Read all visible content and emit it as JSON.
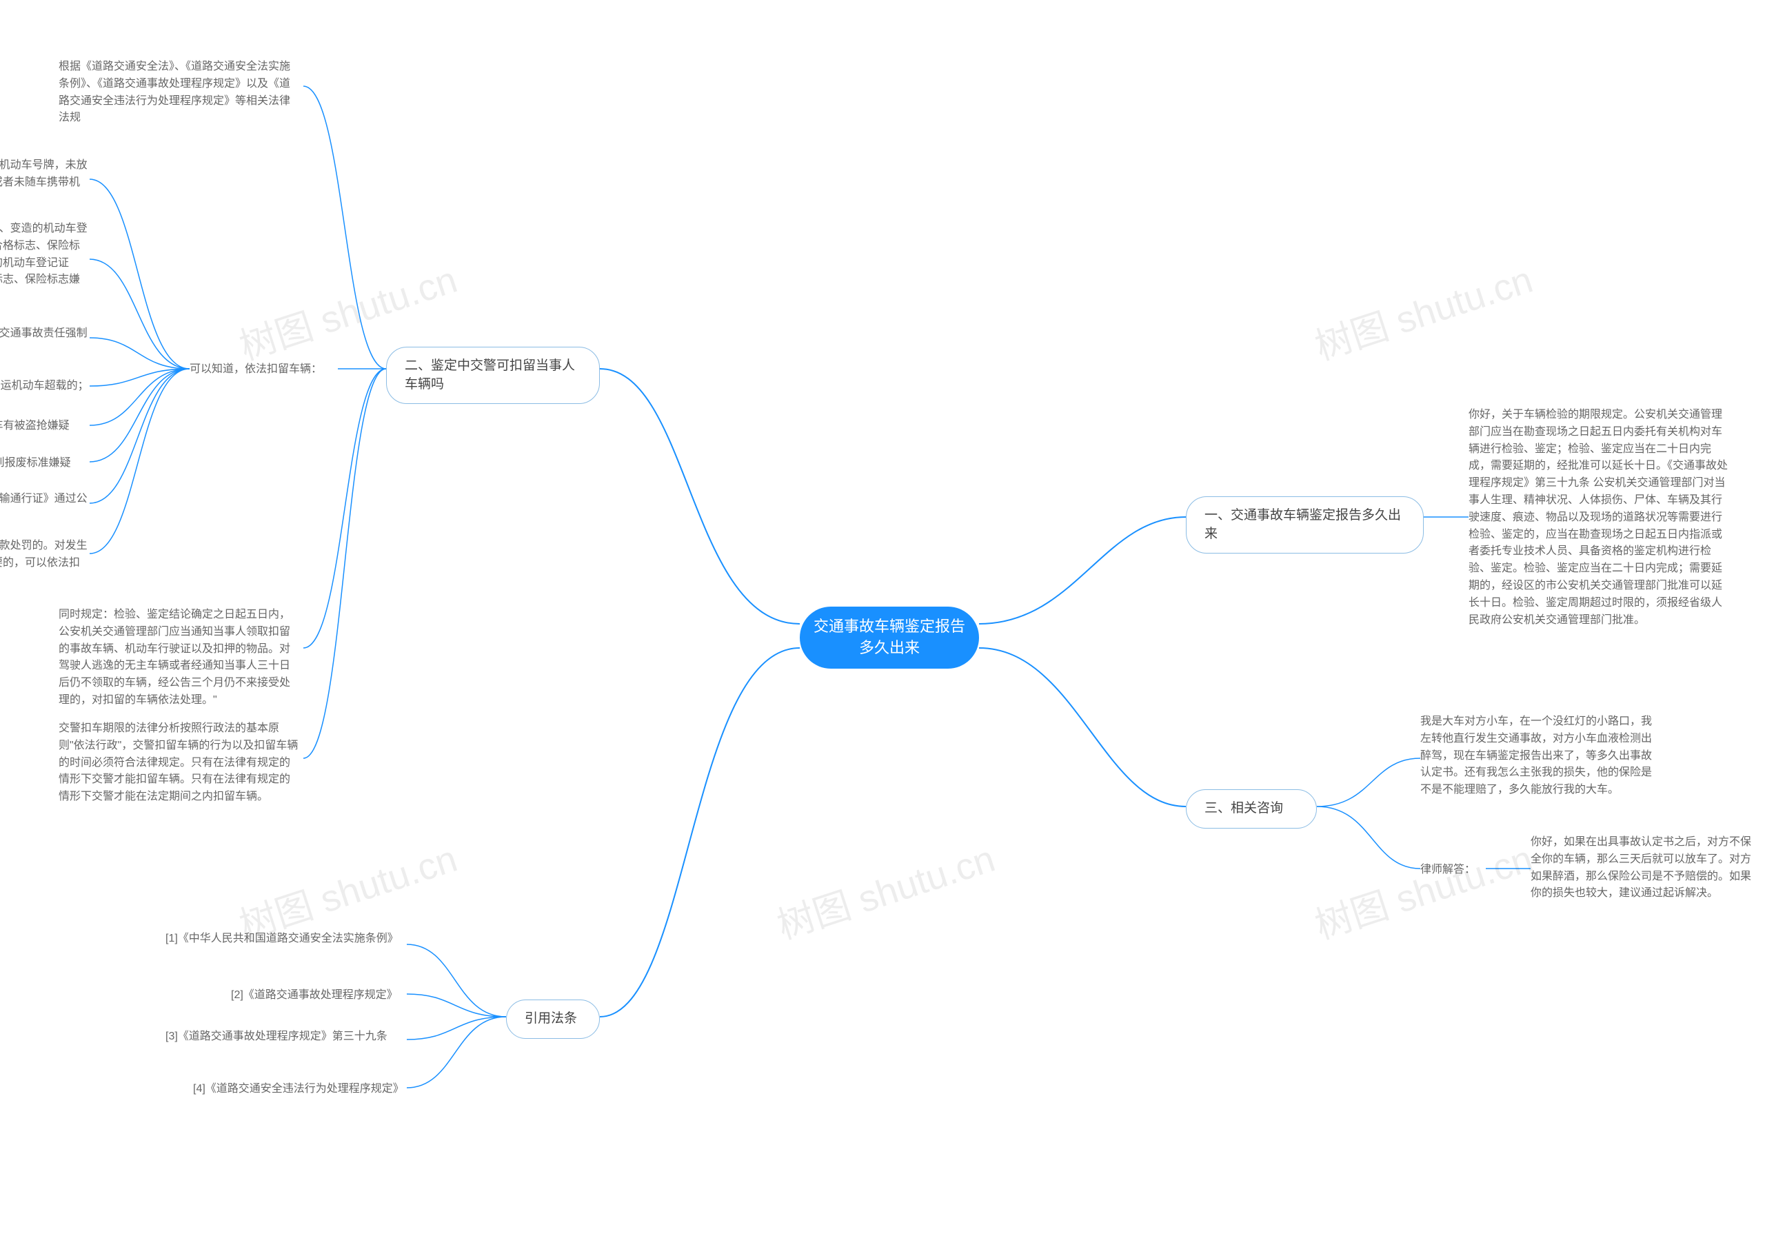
{
  "center": "交通事故车辆鉴定报告多久出来",
  "right": {
    "branch1": {
      "label": "一、交通事故车辆鉴定报告多久出来",
      "leaf": "你好，关于车辆检验的期限规定。公安机关交通管理部门应当在勘查现场之日起五日内委托有关机构对车辆进行检验、鉴定；检验、鉴定应当在二十日内完成，需要延期的，经批准可以延长十日。《交通事故处理程序规定》第三十九条 公安机关交通管理部门对当事人生理、精神状况、人体损伤、尸体、车辆及其行驶速度、痕迹、物品以及现场的道路状况等需要进行检验、鉴定的，应当在勘查现场之日起五日内指派或者委托专业技术人员、具备资格的鉴定机构进行检验、鉴定。检验、鉴定应当在二十日内完成；需要延期的，经设区的市公安机关交通管理部门批准可以延长十日。检验、鉴定周期超过时限的，须报经省级人民政府公安机关交通管理部门批准。"
    },
    "branch3": {
      "label": "三、相关咨询",
      "leaf_a": "我是大车对方小车，在一个没红灯的小路口，我左转他直行发生交通事故，对方小车血液检测出醉驾，现在车辆鉴定报告出来了，等多久出事故认定书。还有我怎么主张我的损失，他的保险是不是不能理赔了，多久能放行我的大车。",
      "lawyer_label": "律师解答：",
      "leaf_b": "你好，如果在出具事故认定书之后，对方不保全你的车辆，那么三天后就可以放车了。对方如果醉酒，那么保险公司是不予赔偿的。如果你的损失也较大，建议通过起诉解决。"
    }
  },
  "left": {
    "branch2": {
      "label": "二、鉴定中交警可扣留当事人车辆吗",
      "top_leaf": "根据《道路交通安全法》、《道路交通安全法实施条例》、《道路交通事故处理程序规定》以及《道路交通安全违法行为处理程序规定》等相关法律法规",
      "know_label": "可以知道，依法扣留车辆：",
      "items": {
        "i1": "(一)上道路行驶的机动车未悬挂机动车号牌，未放置检验合格标志、保险标志，或者未随车携带机动车行驶证、驾驶证的；",
        "i2": "(二)有伪造、变造或者使用伪造、变造的机动车登记证书、号牌、行驶证、检验合格标志、保险标志、驾驶证或者使用其他车辆的机动车登记证书、号牌、行驶证、检验合格标志、保险标志嫌疑的；",
        "i3": "(三)未按照国家规定投保机动车交通事故责任强制保险的；",
        "i4": "(四)公路客运车辆或者货运机动车超载的；",
        "i5": "(五)机动车有被盗抢嫌疑的；",
        "i6": "(六)机动车有拼装或者达到报废标准嫌疑的；",
        "i7": "(七)未申领《剧毒化学品公路运输通行证》通过公路运输剧毒化学品的；",
        "i8": "(八)非机动车驾驶人拒绝接受罚款处罚的。对发生道路交通事故，因收集证据需要的，可以依法扣留事故车辆。\""
      },
      "bottom_a": "同时规定：检验、鉴定结论确定之日起五日内，公安机关交通管理部门应当通知当事人领取扣留的事故车辆、机动车行驶证以及扣押的物品。对驾驶人逃逸的无主车辆或者经通知当事人三十日后仍不领取的车辆，经公告三个月仍不来接受处理的，对扣留的车辆依法处理。\"",
      "bottom_b": "交警扣车期限的法律分析按照行政法的基本原则\"依法行政\"，交警扣留车辆的行为以及扣留车辆的时间必须符合法律规定。只有在法律有规定的情形下交警才能扣留车辆。只有在法律有规定的情形下交警才能在法定期间之内扣留车辆。"
    },
    "branch_law": {
      "label": "引用法条",
      "refs": {
        "r1": "[1]《中华人民共和国道路交通安全法实施条例》",
        "r2": "[2]《道路交通事故处理程序规定》",
        "r3": "[3]《道路交通事故处理程序规定》第三十九条",
        "r4": "[4]《道路交通安全违法行为处理程序规定》"
      }
    }
  },
  "watermark": "树图 shutu.cn"
}
